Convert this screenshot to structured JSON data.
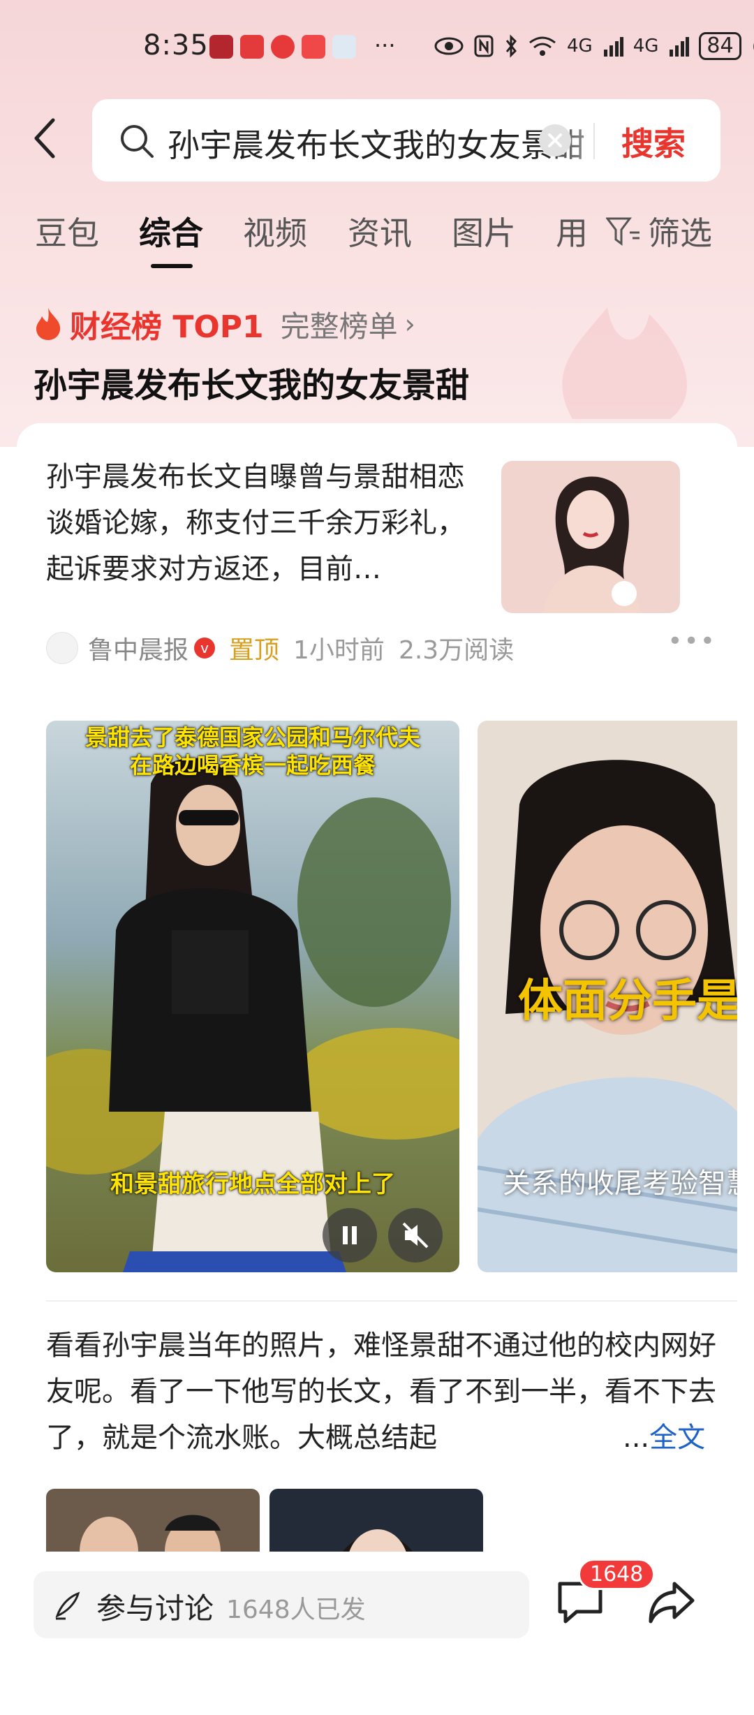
{
  "status_bar": {
    "time": "8:35",
    "more_dots": "···",
    "battery": "84",
    "network_a": "4G",
    "network_b": "4G"
  },
  "search": {
    "query": "孙宇晨发布长文我的女友景甜",
    "button_label": "搜索"
  },
  "tabs": [
    {
      "label": "豆包"
    },
    {
      "label": "综合"
    },
    {
      "label": "视频"
    },
    {
      "label": "资讯"
    },
    {
      "label": "图片"
    },
    {
      "label": "用"
    }
  ],
  "filter_label": "筛选",
  "hot_list": {
    "label": "财经榜 TOP1",
    "full_link": "完整榜单",
    "title": "孙宇晨发布长文我的女友景甜"
  },
  "news": {
    "text": "孙宇晨发布长文自曝曾与景甜相恋谈婚论嫁，称支付三千余万彩礼，起诉要求对方返还，目前…",
    "source": "鲁中晨报",
    "pin": "置顶",
    "time": "1小时前",
    "reads": "2.3万阅读"
  },
  "videos": [
    {
      "caption_top_1": "景甜去了泰德国家公园和马尔代夫",
      "caption_top_2": "在路边喝香槟一起吃西餐",
      "caption_mid": "和景甜旅行地点全部对上了"
    },
    {
      "caption_big": "体面分手是",
      "caption_white": "关系的收尾考验智慧"
    }
  ],
  "post": {
    "text": "看看孙宇晨当年的照片，难怪景甜不通过他的校内网好友呢。看了一下他写的长文，看了不到一半，看不下去了，就是个流水账。大概总结起",
    "ellipsis": "...",
    "full_label": "全文"
  },
  "bottom": {
    "discuss_label": "参与讨论",
    "discuss_count": "1648人已发",
    "comment_badge": "1648"
  },
  "colors": {
    "accent_red": "#e8362f",
    "link_blue": "#1f63c6",
    "pin_gold": "#d9a020"
  }
}
